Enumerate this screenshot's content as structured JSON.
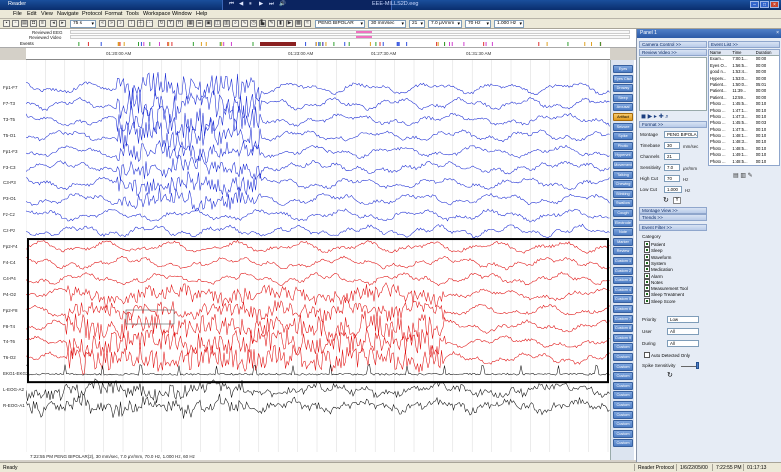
{
  "titlebar": {
    "app_name": "Reader",
    "file_name": "EEE-MILLS2D.eeg",
    "media_controls": [
      "⏮",
      "◀",
      "⏸",
      "▶",
      "⏭",
      "🔊"
    ]
  },
  "menu": [
    "File",
    "Edit",
    "View",
    "Navigate",
    "Protocol",
    "Format",
    "Tools",
    "Workspace",
    "Window",
    "Help"
  ],
  "toolbar": {
    "zoom": "75 s",
    "montage": "PENG BIPOLAR",
    "timebase": "30 mm/sec",
    "channels": "21",
    "sensitivity": "7.0 µV/mm",
    "high_cut": "70 Hz",
    "low_cut": "1.000 Hz"
  },
  "review": {
    "eeg_label": "Reviewed EEG",
    "video_label": "Reviewed Video",
    "events_label": "Events"
  },
  "timeruler": [
    "01:20:00 AM",
    "01:23:00 AM",
    "01:27:30 AM",
    "01:31:30 AM"
  ],
  "channels": [
    "Fp1-F7",
    "F7-T3",
    "T3-T5",
    "T5-O1",
    "Fp1-F3",
    "F3-C3",
    "C3-P3",
    "P3-O1",
    "Fz-Cz",
    "Cz-Pz",
    "Fp2-F4",
    "F4-C4",
    "C4-P4",
    "P4-O2",
    "Fp2-F8",
    "F8-T4",
    "T4-T6",
    "T6-O2",
    "EKG1-EKG2",
    "L-EOG-A2",
    "R-EOG-A1"
  ],
  "eeg_caption": "7:22:55 PM PENG BIPOLAR(2), 30 mm/sec, 7.0 µV/mm, 70.0 Hz, 1.000 Hz, 60 Hz",
  "side_buttons": [
    "Eyes Open",
    "Eyes Clsd",
    "Drowsy",
    "Sleep",
    "Arousal",
    "Artifact",
    "Seizure",
    "Spike",
    "Photic",
    "Hypervnt",
    "Movement",
    "Talking",
    "Chewing",
    "Blinking",
    "Swallow",
    "Cough",
    "Electrode",
    "Note",
    "Marker",
    "Review",
    "Custom 1",
    "Custom 2",
    "Custom 3",
    "Custom 4",
    "Custom 5",
    "Custom 6",
    "Custom 7",
    "Custom 8",
    "Custom 9",
    "Custom 10",
    "Custom 11",
    "Custom 12",
    "Custom 13",
    "Custom 14",
    "Custom 15",
    "Custom 16",
    "Custom 17",
    "Custom 18",
    "Custom 19",
    "Custom 20"
  ],
  "active_button_index": 5,
  "panel": {
    "title": "Panel 1",
    "camera_control": "Camera Control >>",
    "review_video": "Review Video >>",
    "format": "Format >>",
    "event_list": "Event List >>",
    "montage_view": "Montage View >>",
    "trends": "Trends >>",
    "event_filter": "Event Filter >>",
    "format_fields": {
      "montage_label": "Montage",
      "montage": "PENG BIPOLA",
      "timebase_label": "Timebase",
      "timebase": "30",
      "timebase_unit": "mm/sec",
      "channels_label": "Channels",
      "channels": "21",
      "sensitivity_label": "Sensitivity",
      "sensitivity": "7.0",
      "sensitivity_unit": "µV/mm",
      "highcut_label": "High Cut",
      "highcut": "70",
      "highcut_unit": "Hz",
      "lowcut_label": "Low Cut",
      "lowcut": "1.000",
      "lowcut_unit": "Hz"
    },
    "category_label": "Category",
    "categories": [
      "Patient",
      "Sleep",
      "Waveform",
      "System",
      "Medication",
      "Alarm",
      "Notes",
      "Measurement Tool",
      "Sleep Treatment",
      "Sleep Score"
    ],
    "priority_label": "Priority",
    "priority": "Low",
    "user_label": "User",
    "user": "All",
    "during_label": "During",
    "during": "All",
    "auto_detected": "Auto Detected Only",
    "spike_sensitivity": "Spike Sensitivity"
  },
  "event_list": {
    "headers": [
      "Name",
      "Time",
      "Duration"
    ],
    "rows": [
      [
        "Exam...",
        "7:00:1...",
        "00:00"
      ],
      [
        "Eyes O...",
        "1:56:5...",
        "00:00"
      ],
      [
        "good n...",
        "1:53:4...",
        "00:00"
      ],
      [
        "Hyperv...",
        "1:53:0...",
        "00:00"
      ],
      [
        "Patient...",
        "1:50:0...",
        "05:01"
      ],
      [
        "Patient...",
        "11:39...",
        "00:00"
      ],
      [
        "Patient...",
        "12:59...",
        "00:00"
      ],
      [
        "Photo ...",
        "1:45:5...",
        "00:10"
      ],
      [
        "Photo ...",
        "1:47:1...",
        "00:10"
      ],
      [
        "Photo ...",
        "1:47:3...",
        "00:10"
      ],
      [
        "Photo ...",
        "1:45:5...",
        "00:03"
      ],
      [
        "Photo ...",
        "1:47:5...",
        "00:10"
      ],
      [
        "Photo ...",
        "1:48:1...",
        "00:10"
      ],
      [
        "Photo ...",
        "1:48:3...",
        "00:10"
      ],
      [
        "Photo ...",
        "1:48:5...",
        "00:10"
      ],
      [
        "Photo ...",
        "1:49:1...",
        "00:10"
      ],
      [
        "Photo ...",
        "1:48:5...",
        "00:10"
      ]
    ]
  },
  "status": {
    "left": "Ready",
    "mode": "Reader Protocol",
    "date": "1/6/22/05/00",
    "time1": "7:22:55 PM",
    "time2": "01:17:13"
  },
  "colors": {
    "left_hemisphere": "#1a2bd4",
    "right_hemisphere": "#e01010",
    "other": "#111111",
    "highlight_box": "#000000"
  }
}
